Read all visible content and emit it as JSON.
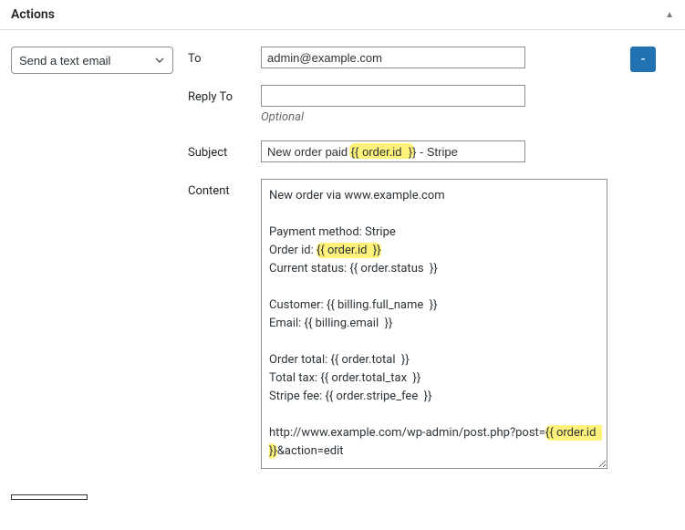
{
  "panel": {
    "title": "Actions"
  },
  "action": {
    "type_label": "Send a text email"
  },
  "labels": {
    "to": "To",
    "reply_to": "Reply To",
    "subject": "Subject",
    "content": "Content",
    "optional": "Optional"
  },
  "fields": {
    "to": "admin@example.com",
    "reply_to": "",
    "subject": "New order paid {{ order.id  }} - Stripe",
    "content": "New order via www.example.com\n\nPayment method: Stripe\nOrder id: {{ order.id  }}\nCurrent status: {{ order.status  }}\n\nCustomer: {{ billing.full_name  }}\nEmail: {{ billing.email  }}\n\nOrder total: {{ order.total  }}\nTotal tax: {{ order.total_tax  }}\nStripe fee: {{ order.stripe_fee  }}\n\nhttp://www.example.com/wp-admin/post.php?post={{ order.id  }}&action=edit"
  },
  "highlight_tokens": [
    "{{ order.id  }}"
  ],
  "remove_label": "-"
}
